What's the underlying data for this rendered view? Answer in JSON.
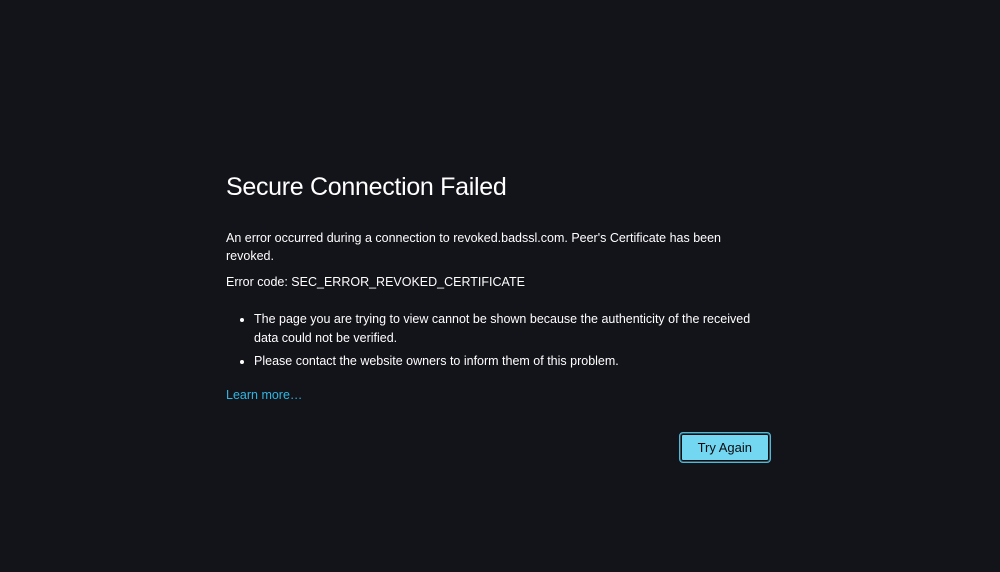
{
  "error": {
    "title": "Secure Connection Failed",
    "description": "An error occurred during a connection to revoked.badssl.com. Peer's Certificate has been revoked.",
    "code_line": "Error code: SEC_ERROR_REVOKED_CERTIFICATE",
    "bullets": [
      "The page you are trying to view cannot be shown because the authenticity of the received data could not be verified.",
      "Please contact the website owners to inform them of this problem."
    ],
    "learn_more": "Learn more…",
    "try_again": "Try Again"
  }
}
